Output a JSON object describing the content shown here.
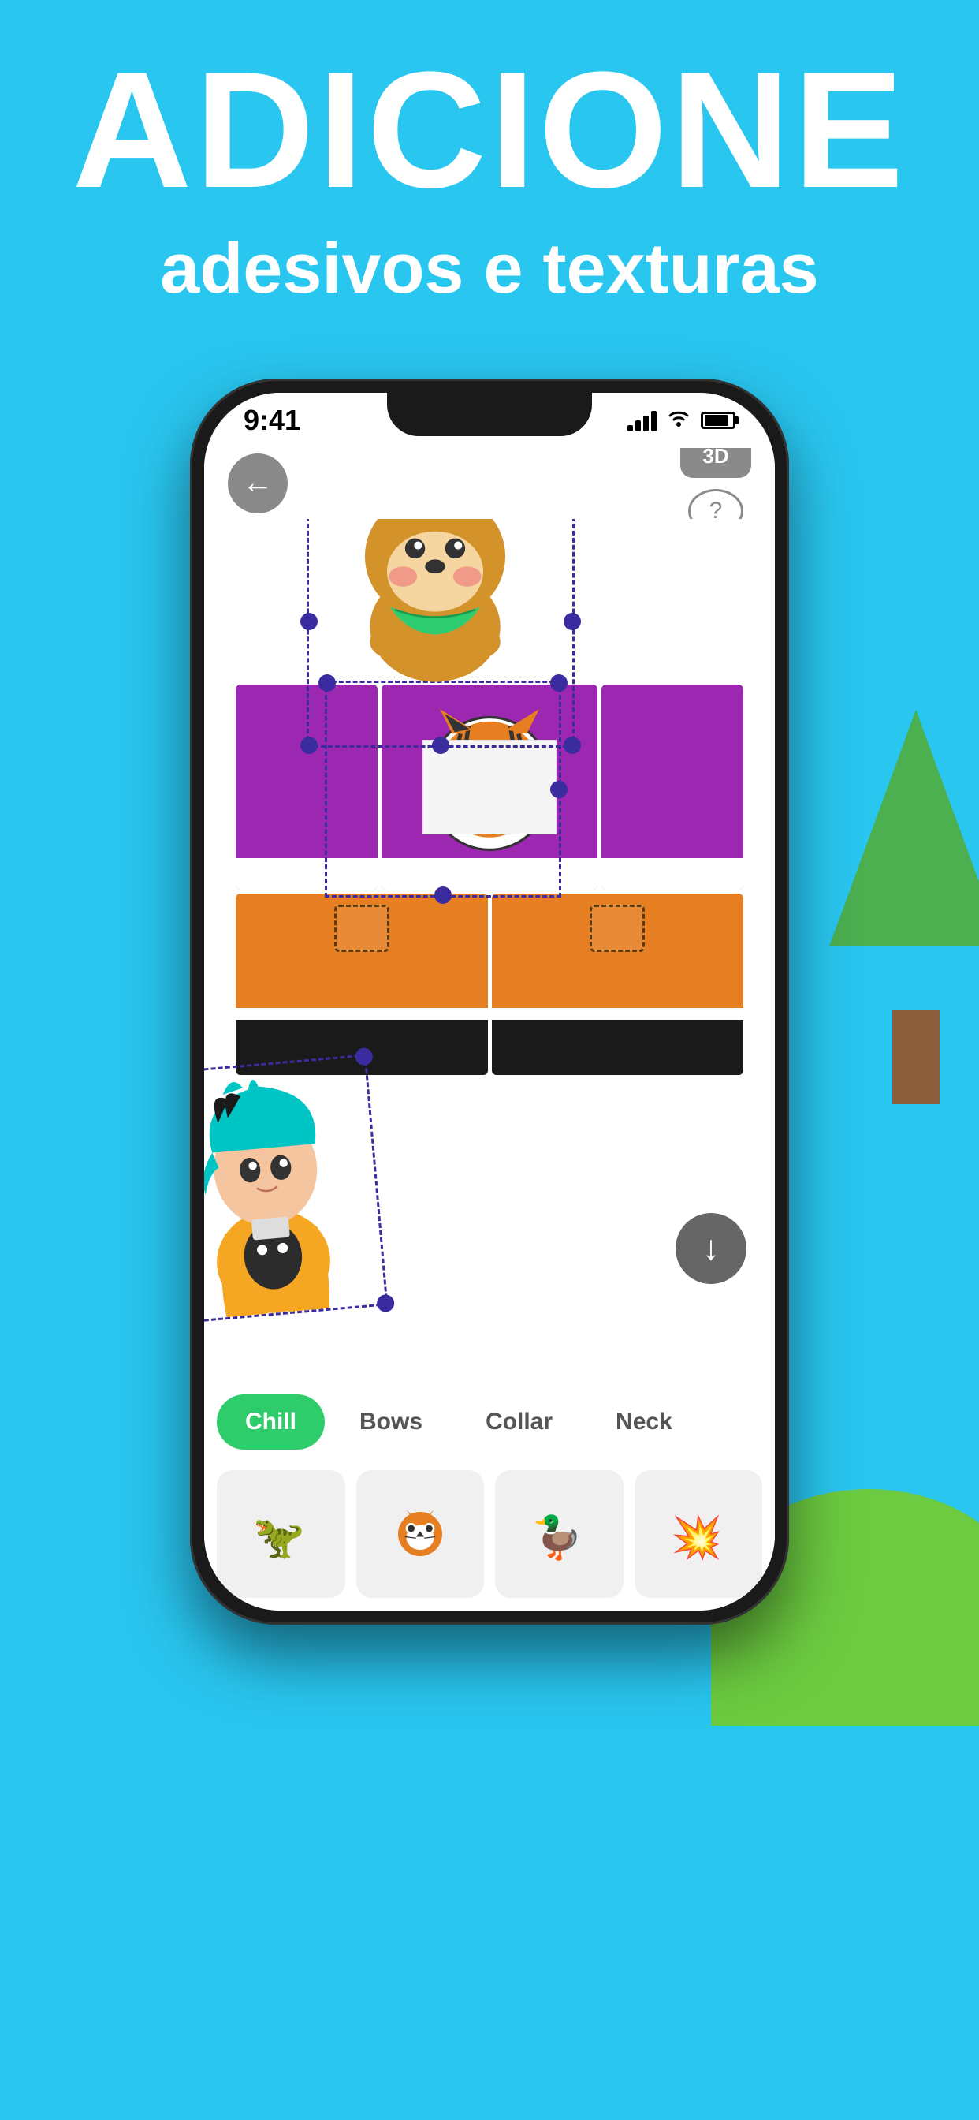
{
  "background_color": "#29c6f0",
  "header": {
    "title": "ADICIONE",
    "subtitle": "adesivos e texturas"
  },
  "phone": {
    "status_bar": {
      "time": "9:41",
      "signal": "full",
      "wifi": true,
      "battery": "full"
    },
    "toolbar": {
      "back_label": "←",
      "btn_3d_label": "3D",
      "btn_help_label": "?"
    },
    "download_button_label": "↓",
    "tabs": [
      {
        "label": "Chill",
        "active": true
      },
      {
        "label": "Bows",
        "active": false
      },
      {
        "label": "Collar",
        "active": false
      },
      {
        "label": "Neck",
        "active": false
      }
    ],
    "stickers": [
      {
        "emoji": "🦖",
        "label": "dinosaur"
      },
      {
        "emoji": "🐯",
        "label": "tiger"
      },
      {
        "emoji": "🦆",
        "label": "duck"
      },
      {
        "emoji": "💥",
        "label": "explosion"
      }
    ]
  },
  "colors": {
    "sky_blue": "#29c6f0",
    "tab_active_bg": "#2ecc6b",
    "tab_active_text": "#ffffff",
    "tab_inactive_text": "#555555",
    "purple": "#9c27b0",
    "orange": "#e67e22",
    "selection_border": "#3a2c9e",
    "button_gray": "#8a8a8a"
  }
}
